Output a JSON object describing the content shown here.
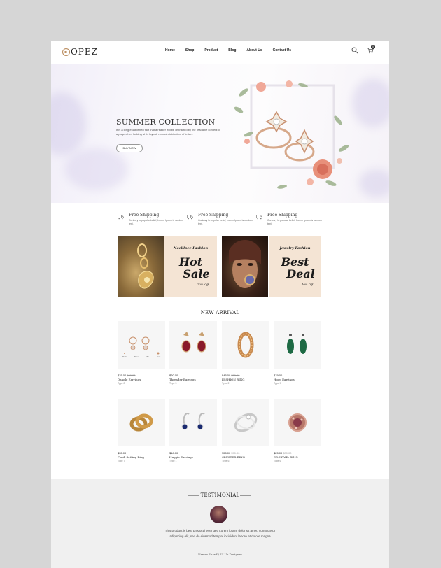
{
  "header": {
    "logo": "OPEZ",
    "nav": [
      "Home",
      "Shop",
      "Product",
      "Blog",
      "About Us",
      "Contact Us"
    ],
    "cart_count": "0"
  },
  "hero": {
    "title": "SUMMER COLLECTION",
    "text": "It is a long established fact that a reader will be distracted by the readable content of a page when looking at its layout, normal distribution of letters",
    "button": "BUY NOW"
  },
  "features": [
    {
      "title": "Free Shipping",
      "text": "Contrary to popular belief, Lorem Ipsum is random text."
    },
    {
      "title": "Free Shipping",
      "text": "Contrary to popular belief, Lorem Ipsum is random text."
    },
    {
      "title": "Free Shipping",
      "text": "Contrary to popular belief, Lorem Ipsum is random text."
    }
  ],
  "banners": [
    {
      "small": "Necklace Fashion",
      "line1": "Hot",
      "line2": "Sale",
      "pct": "70% Off"
    },
    {
      "small": "Jewelry Fashion",
      "line1": "Best",
      "line2": "Deal",
      "pct": "40% Off"
    }
  ],
  "new_arrival": {
    "title": "NEW ARRIVAL",
    "products": [
      {
        "price": "$35.00",
        "old": "$40.00",
        "name": "Dangle Earrings",
        "type": "Type 8"
      },
      {
        "price": "$20.00",
        "old": "",
        "name": "Threader Earrings",
        "type": "Type 5"
      },
      {
        "price": "$45.00",
        "old": "$50.00",
        "name": "FASHION RING",
        "type": "Type 2"
      },
      {
        "price": "$79.00",
        "old": "",
        "name": "Hoop Earrings",
        "type": "Type 9"
      },
      {
        "price": "$35.00",
        "old": "",
        "name": "Flush Setting Ring",
        "type": "Type 7"
      },
      {
        "price": "$18.00",
        "old": "",
        "name": "Huggie Earrings",
        "type": "Type 1"
      },
      {
        "price": "$55.00",
        "old": "$70.00",
        "name": "CLUSTER RING",
        "type": "Type 6"
      },
      {
        "price": "$25.00",
        "old": "$30.00",
        "name": "COCKTAIL RING",
        "type": "Type 6"
      }
    ],
    "earring_labels": [
      "Dazz",
      "Wave",
      "Min",
      "Sev"
    ]
  },
  "testimonial": {
    "title": "TESTIMONIAL",
    "text": "This product is best product i ever get. Lorem ipsum dolor sit amet, consectetur adipiscing elit, sed do eiusmod tempor incididunt labore et dolore magna",
    "author": "Newaz Sharif / UI Ux Designer"
  },
  "colors": {
    "accent": "#b8895a",
    "banner_bg": "#f4e4d4",
    "testimonial_bg": "#f0f0f0",
    "product_bg": "#f6f6f6"
  }
}
